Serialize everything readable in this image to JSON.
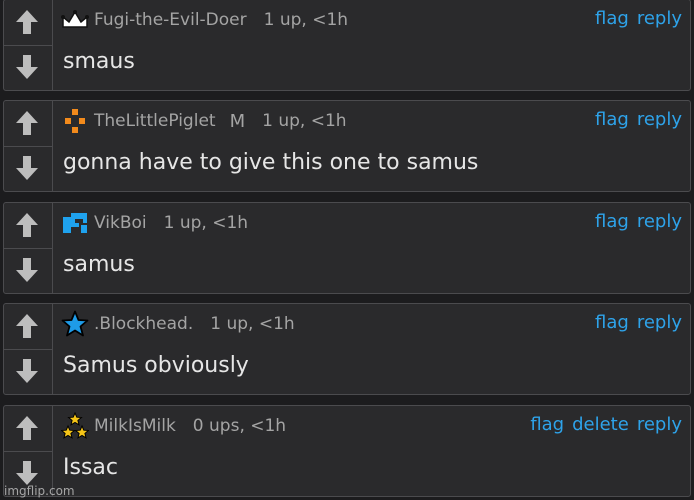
{
  "comments": [
    {
      "username": "Fugi-the-Evil-Doer",
      "badge": "",
      "points": "1 up, <1h",
      "text": "smaus",
      "avatar": "crown-icon",
      "actions": [
        "flag",
        "reply"
      ]
    },
    {
      "username": "TheLittlePiglet",
      "badge": "M",
      "points": "1 up, <1h",
      "text": "gonna have to give this one to samus",
      "avatar": "orange-cross-icon",
      "actions": [
        "flag",
        "reply"
      ]
    },
    {
      "username": "VikBoi",
      "badge": "",
      "points": "1 up, <1h",
      "text": "samus",
      "avatar": "blue-blocks-icon",
      "actions": [
        "flag",
        "reply"
      ]
    },
    {
      "username": ".Blockhead.",
      "badge": "",
      "points": "1 up, <1h",
      "text": "Samus obviously",
      "avatar": "star-icon",
      "actions": [
        "flag",
        "reply"
      ]
    },
    {
      "username": "MilkIsMilk",
      "badge": "",
      "points": "0 ups, <1h",
      "text": "Issac",
      "avatar": "triple-star-icon",
      "actions": [
        "flag",
        "delete",
        "reply"
      ]
    }
  ],
  "watermark": "imgflip.com",
  "colors": {
    "background": "#1c1c1e",
    "card": "#2a2a2c",
    "border": "#4b4b4e",
    "text": "#e6e6e6",
    "meta": "#a4a4a4",
    "link": "#2ea3ea",
    "arrow": "#bdbdbd"
  }
}
